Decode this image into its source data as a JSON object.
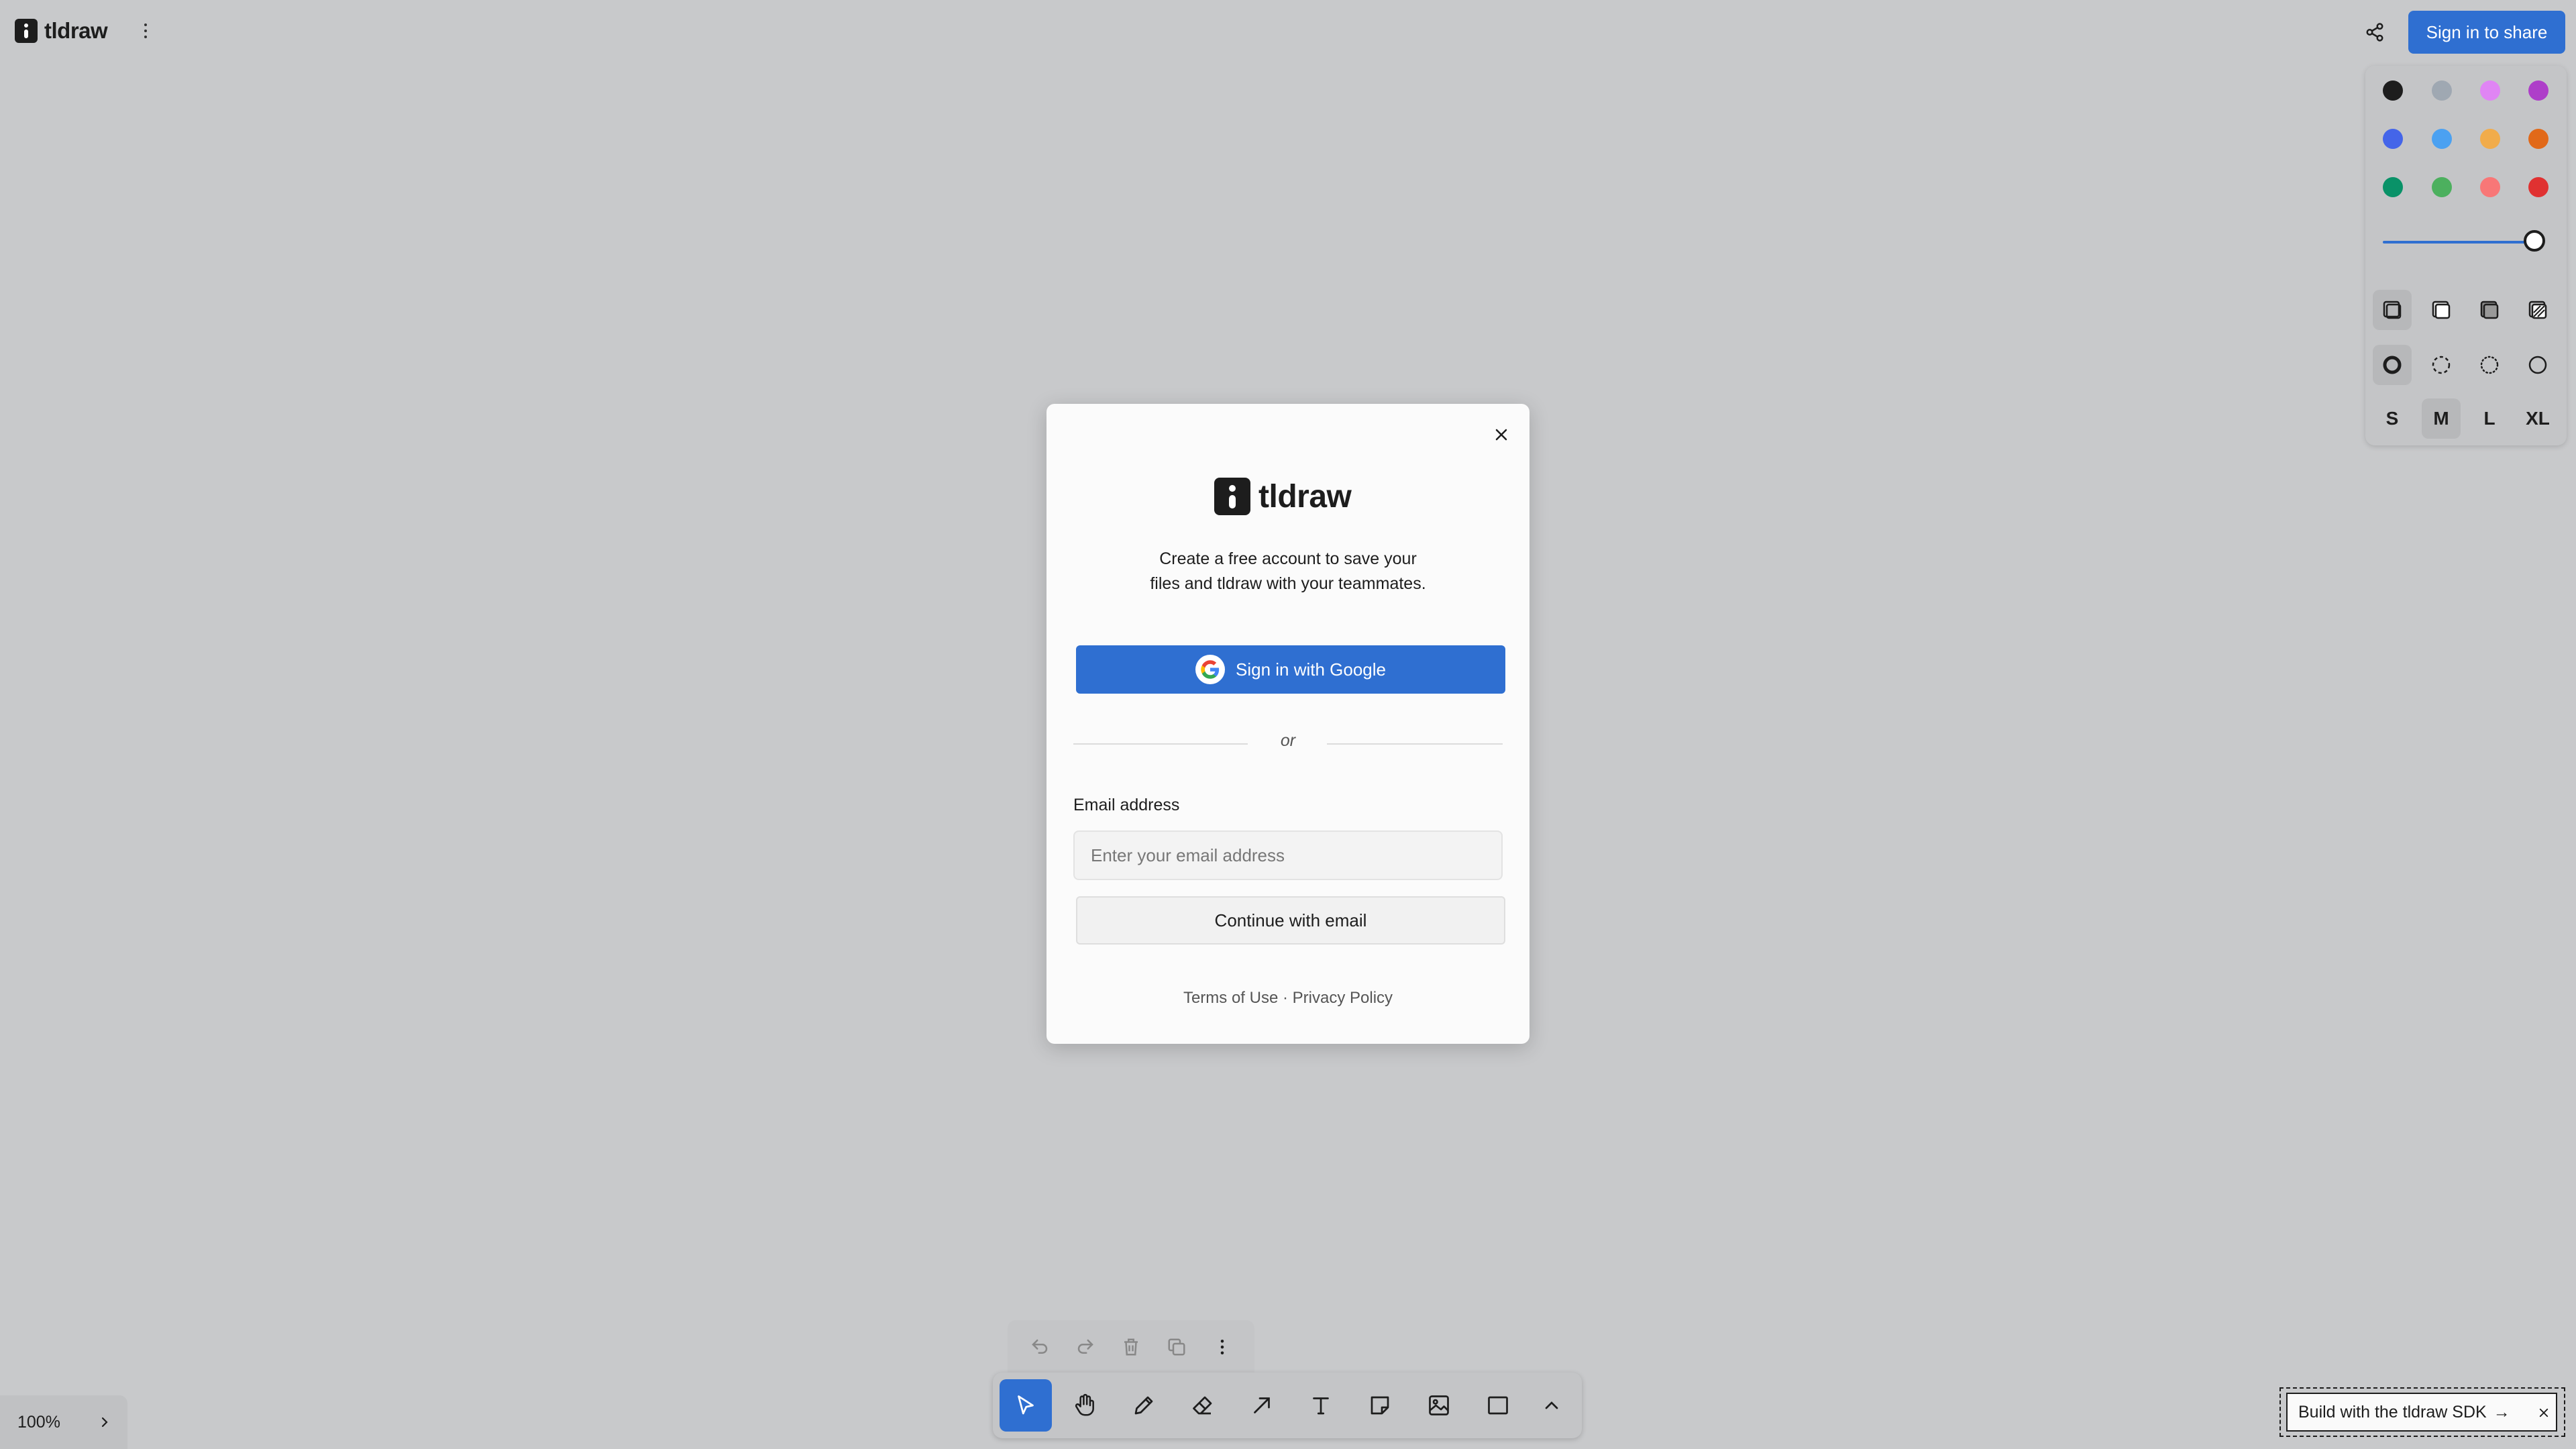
{
  "app": {
    "name": "tldraw"
  },
  "header": {
    "share_button": "Sign in to share"
  },
  "style_panel": {
    "colors": [
      {
        "name": "black",
        "hex": "#1d1d1d"
      },
      {
        "name": "grey",
        "hex": "#9fa8b2"
      },
      {
        "name": "light-violet",
        "hex": "#e085f4"
      },
      {
        "name": "violet",
        "hex": "#ae3ec9"
      },
      {
        "name": "blue",
        "hex": "#4465e9"
      },
      {
        "name": "light-blue",
        "hex": "#4ba1f1"
      },
      {
        "name": "yellow",
        "hex": "#f1ac4b"
      },
      {
        "name": "orange",
        "hex": "#e16919"
      },
      {
        "name": "green",
        "hex": "#099268"
      },
      {
        "name": "light-green",
        "hex": "#4cb05e"
      },
      {
        "name": "light-red",
        "hex": "#f87777"
      },
      {
        "name": "red",
        "hex": "#e03131"
      }
    ],
    "opacity": 1,
    "fill_options": [
      "none",
      "semi",
      "solid",
      "pattern"
    ],
    "dash_options": [
      "draw",
      "dashed",
      "dotted",
      "solid"
    ],
    "sizes": [
      "S",
      "M",
      "L",
      "XL"
    ],
    "selected_size": "M"
  },
  "modal": {
    "brand": "tldraw",
    "description_line1": "Create a free account to save your",
    "description_line2": "files and tldraw with your teammates.",
    "google_button": "Sign in with Google",
    "divider": "or",
    "email_label": "Email address",
    "email_placeholder": "Enter your email address",
    "email_value": "",
    "continue_button": "Continue with email",
    "terms": "Terms of Use",
    "separator": "·",
    "privacy": "Privacy Policy"
  },
  "quick_actions": [
    "undo",
    "redo",
    "delete",
    "duplicate",
    "more"
  ],
  "toolbar": {
    "tools": [
      "select",
      "hand",
      "draw",
      "eraser",
      "arrow",
      "text",
      "note",
      "asset",
      "rectangle",
      "more"
    ],
    "active": "select"
  },
  "zoom": {
    "label": "100%"
  },
  "sdk_banner": {
    "text": "Build with the tldraw SDK",
    "arrow": "→"
  }
}
